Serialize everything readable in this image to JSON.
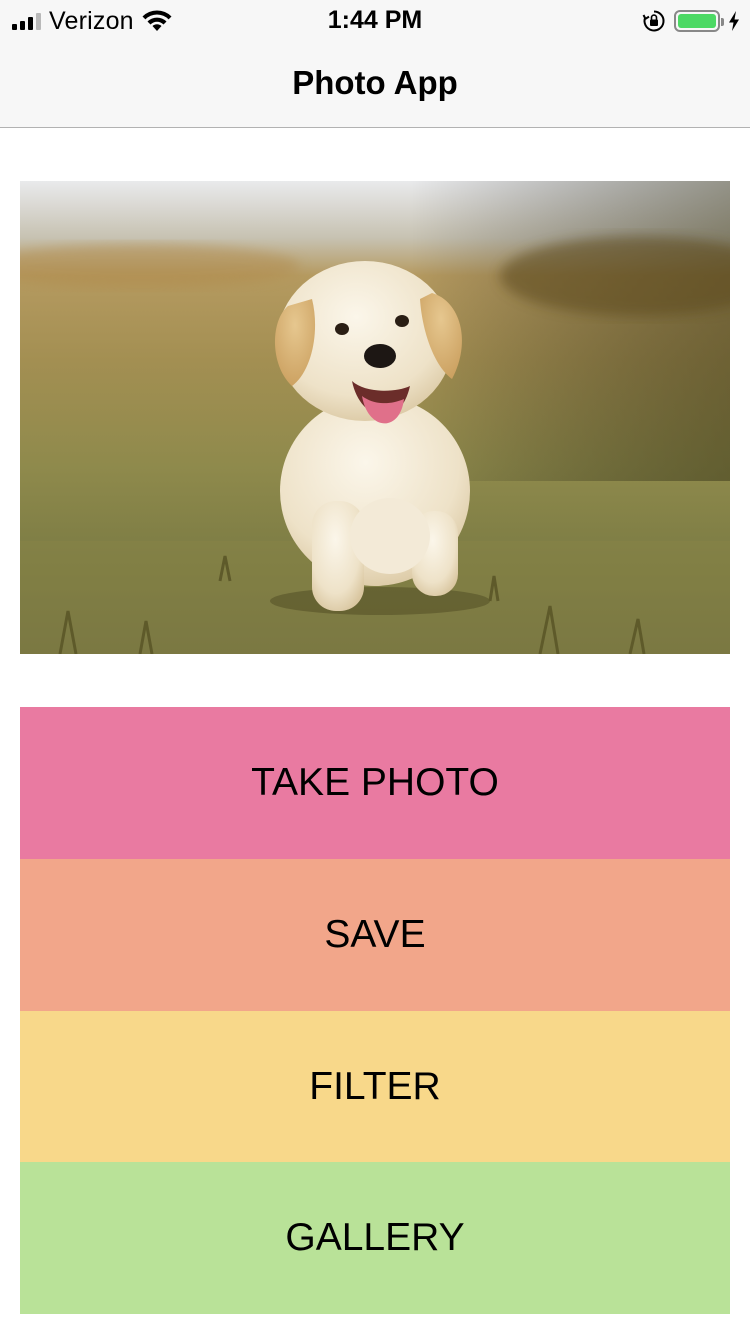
{
  "status_bar": {
    "carrier": "Verizon",
    "time": "1:44 PM",
    "icons": [
      "signal-icon",
      "wifi-icon",
      "orientation-lock-icon",
      "battery-icon",
      "charging-bolt-icon"
    ],
    "battery_color": "#4cd964"
  },
  "nav": {
    "title": "Photo App"
  },
  "photo": {
    "subject": "puppy-photo"
  },
  "buttons": {
    "take_photo": "TAKE PHOTO",
    "save": "SAVE",
    "filter": "FILTER",
    "gallery": "GALLERY"
  },
  "colors": {
    "take_photo": "#e97aa1",
    "save": "#f2a68a",
    "filter": "#f8d88a",
    "gallery": "#b9e298"
  }
}
